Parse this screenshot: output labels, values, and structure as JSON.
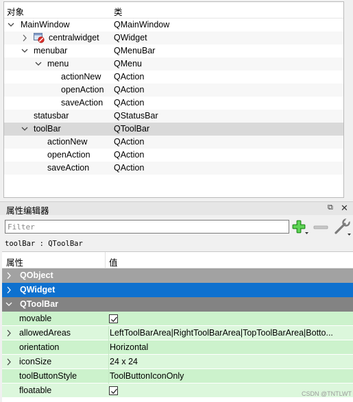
{
  "inspector": {
    "col_object": "对象",
    "col_class": "类",
    "rows": [
      {
        "name": "MainWindow",
        "cls": "QMainWindow",
        "arrow": "⌄"
      },
      {
        "name": "centralwidget",
        "cls": "QWidget",
        "arrow": "›",
        "icon": "widget-forbidden-icon"
      },
      {
        "name": "menubar",
        "cls": "QMenuBar",
        "arrow": "⌄"
      },
      {
        "name": "menu",
        "cls": "QMenu",
        "arrow": "⌄"
      },
      {
        "name": "actionNew",
        "cls": "QAction"
      },
      {
        "name": "openAction",
        "cls": "QAction"
      },
      {
        "name": "saveAction",
        "cls": "QAction"
      },
      {
        "name": "statusbar",
        "cls": "QStatusBar"
      },
      {
        "name": "toolBar",
        "cls": "QToolBar",
        "arrow": "⌄",
        "selected": true
      },
      {
        "name": "actionNew",
        "cls": "QAction"
      },
      {
        "name": "openAction",
        "cls": "QAction"
      },
      {
        "name": "saveAction",
        "cls": "QAction"
      }
    ]
  },
  "property_editor": {
    "title": "属性编辑器",
    "float_glyph": "⧉",
    "close_glyph": "✕",
    "filter_placeholder": "Filter",
    "object_line": "toolBar : QToolBar",
    "col_property": "属性",
    "col_value": "值",
    "groups": {
      "qobject": "QObject",
      "qwidget": "QWidget",
      "qtoolbar": "QToolBar"
    },
    "properties": [
      {
        "name": "movable",
        "value": "",
        "checkbox": true,
        "checked": true
      },
      {
        "name": "allowedAreas",
        "value": "LeftToolBarArea|RightToolBarArea|TopToolBarArea|Botto...",
        "arrow": "›"
      },
      {
        "name": "orientation",
        "value": "Horizontal"
      },
      {
        "name": "iconSize",
        "value": "24 x 24",
        "arrow": "›"
      },
      {
        "name": "toolButtonStyle",
        "value": "ToolButtonIconOnly"
      },
      {
        "name": "floatable",
        "value": "",
        "checkbox": true,
        "checked": true
      }
    ]
  },
  "icons": {
    "add": "plus-icon",
    "remove": "minus-icon",
    "configure": "wrench-icon"
  },
  "colors": {
    "selected_group": "#0e71cf",
    "property_row": "#ccf2cc",
    "property_row_alt": "#dcf7dc"
  },
  "watermark": "CSDN @TNTLWT"
}
